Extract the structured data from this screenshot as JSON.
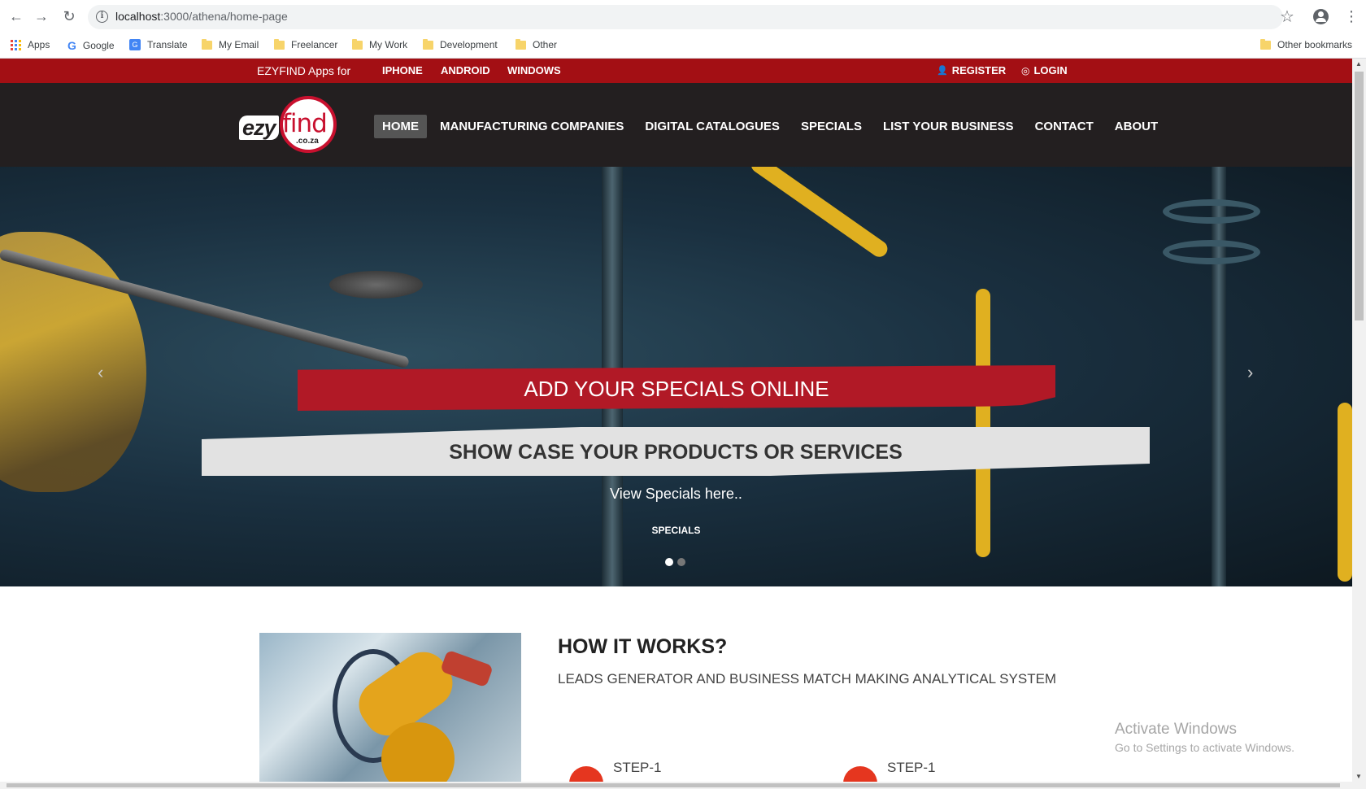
{
  "browser": {
    "url_host": "localhost",
    "url_path": ":3000/athena/home-page",
    "bookmarks": [
      {
        "label": "Apps",
        "icon": "apps-grid-icon"
      },
      {
        "label": "Google",
        "icon": "google-icon"
      },
      {
        "label": "Translate",
        "icon": "translate-icon"
      },
      {
        "label": "My Email",
        "icon": "folder-icon"
      },
      {
        "label": "Freelancer",
        "icon": "folder-icon"
      },
      {
        "label": "My Work",
        "icon": "folder-icon"
      },
      {
        "label": "Development",
        "icon": "folder-icon"
      },
      {
        "label": "Other",
        "icon": "folder-icon"
      }
    ],
    "other_bookmarks": "Other bookmarks"
  },
  "topbar": {
    "apps_for": "EZYFIND Apps for",
    "platforms": [
      "IPHONE",
      "ANDROID",
      "WINDOWS"
    ],
    "register": "REGISTER",
    "login": "LOGIN",
    "bg_color": "#a30f14"
  },
  "logo": {
    "ezy": "ezy",
    "find": "find",
    "coza": ".co.za"
  },
  "nav": {
    "items": [
      "HOME",
      "MANUFACTURING COMPANIES",
      "DIGITAL CATALOGUES",
      "SPECIALS",
      "LIST YOUR BUSINESS",
      "CONTACT",
      "ABOUT"
    ],
    "active": "HOME"
  },
  "hero": {
    "headline": "ADD YOUR SPECIALS ONLINE",
    "subheadline": "SHOW CASE YOUR PRODUCTS OR SERVICES",
    "text": "View Specials here..",
    "link": "SPECIALS",
    "prev": "‹",
    "next": "›",
    "slides": 2,
    "active_slide": 1,
    "headline_color": "#b11926"
  },
  "how": {
    "title": "HOW IT WORKS?",
    "tagline": "LEADS GENERATOR AND BUSINESS MATCH MAKING ANALYTICAL SYSTEM",
    "steps": [
      "STEP-1",
      "STEP-1"
    ]
  },
  "watermark": {
    "line1": "Activate Windows",
    "line2": "Go to Settings to activate Windows."
  }
}
